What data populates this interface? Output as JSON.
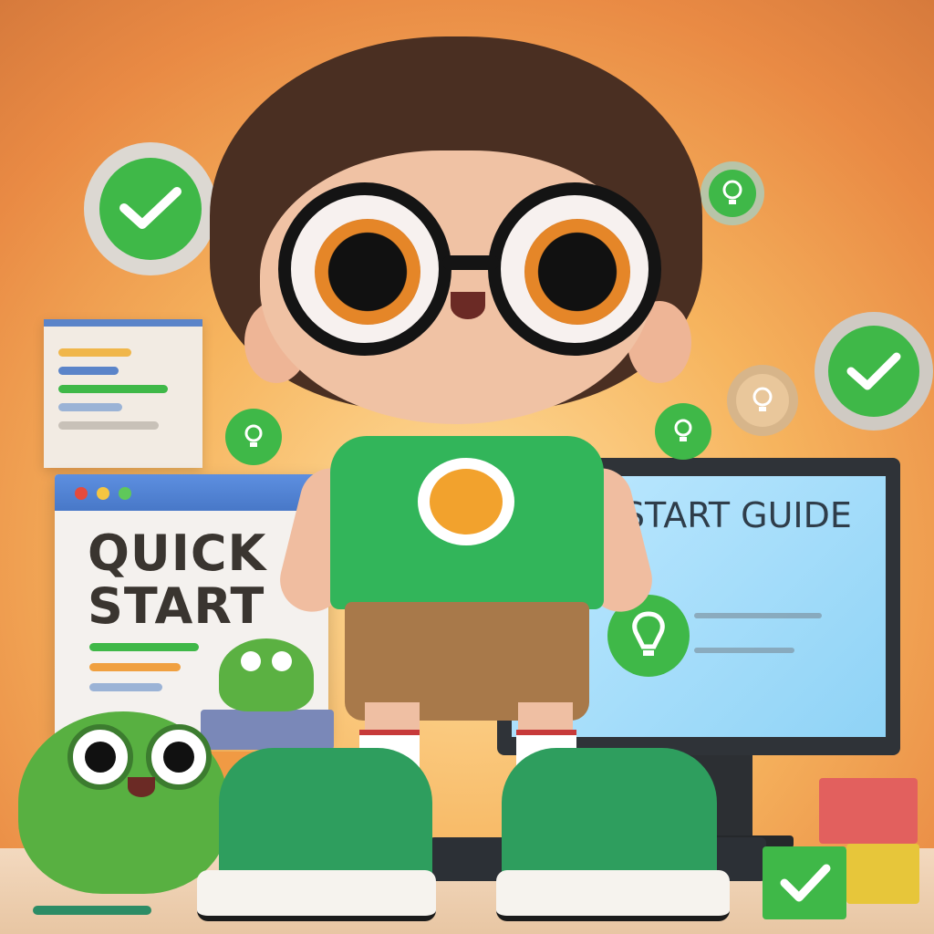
{
  "scene": {
    "browser_panel": {
      "title": "QUICK START"
    },
    "monitor_panel": {
      "title": "ICK START GUIDE"
    }
  },
  "colors": {
    "accent_green": "#3fb848",
    "background": "#f6b45e",
    "hair": "#4a2f22",
    "shirt": "#32b55a"
  },
  "icons": [
    "checkmark-badge-icon",
    "lightbulb-badge-icon",
    "lightbulb-icon"
  ]
}
